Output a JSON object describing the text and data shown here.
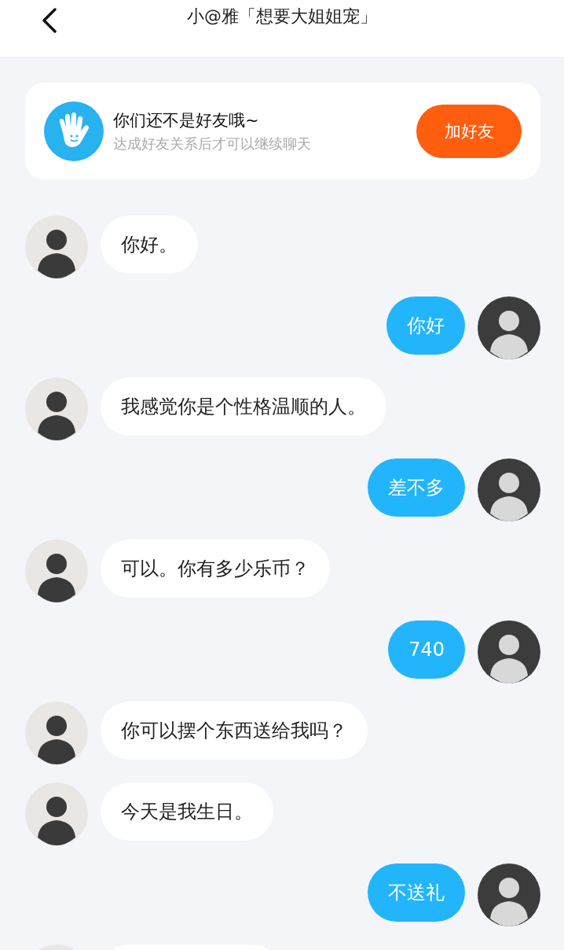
{
  "header": {
    "title": "小@雅「想要大姐姐宠」"
  },
  "friend_notice": {
    "title": "你们还不是好友哦~",
    "subtitle": "达成好友关系后才可以继续聊天",
    "button": "加好友"
  },
  "messages": [
    {
      "kind": "incoming",
      "text": "你好。"
    },
    {
      "kind": "outgoing",
      "text": "你好"
    },
    {
      "kind": "incoming",
      "text": "我感觉你是个性格温顺的人。"
    },
    {
      "kind": "outgoing",
      "text": "差不多"
    },
    {
      "kind": "incoming",
      "text": "可以。你有多少乐币？"
    },
    {
      "kind": "outgoing",
      "text": "740"
    },
    {
      "kind": "incoming",
      "text": "你可以摆个东西送给我吗？"
    },
    {
      "kind": "incoming",
      "text": "今天是我生日。"
    },
    {
      "kind": "outgoing",
      "text": "不送礼"
    },
    {
      "kind": "incoming"
    }
  ]
}
